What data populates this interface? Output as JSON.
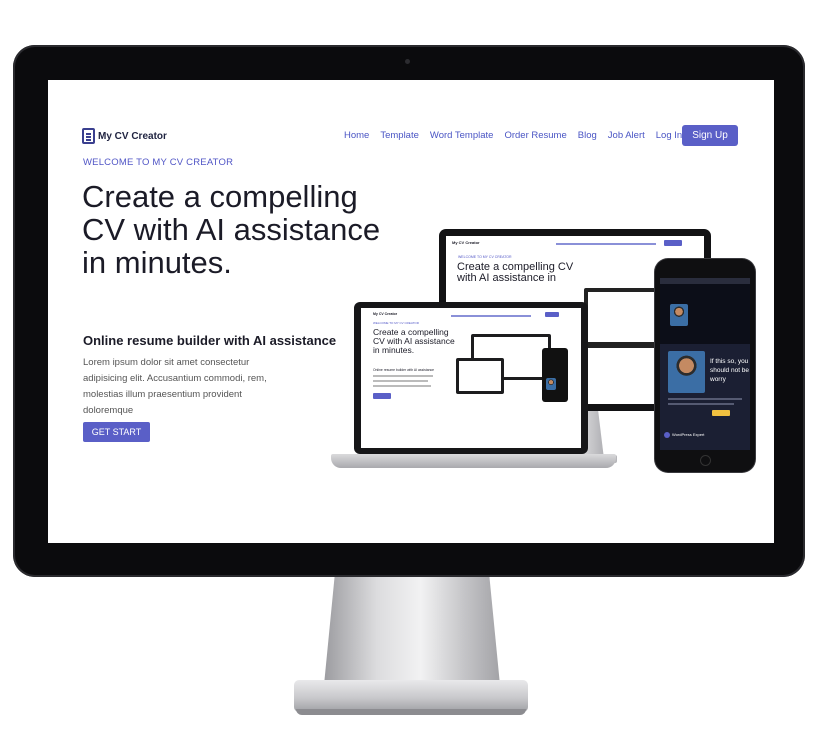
{
  "site": {
    "logo_text": "My CV Creator",
    "nav": [
      "Home",
      "Template",
      "Word Template",
      "Order Resume",
      "Blog",
      "Job Alert",
      "Log In"
    ],
    "signup_label": "Sign Up"
  },
  "hero": {
    "welcome": "WELCOME TO MY CV CREATOR",
    "headline": "Create a compelling CV with AI assistance in minutes.",
    "subheading": "Online resume builder with AI assistance",
    "description": "Lorem ipsum dolor sit amet consectetur adipisicing elit. Accusantium commodi, rem, molestias illum praesentium provident doloremque",
    "cta_label": "GET START"
  },
  "mockups": {
    "monitor": {
      "welcome": "WELCOME TO MY CV CREATOR",
      "headline": "Create a compelling CV with AI assistance in"
    },
    "laptop": {
      "welcome": "WELCOME TO MY CV CREATOR",
      "headline": "Create a compelling CV with AI assistance in minutes.",
      "subheading": "Online resume builder with AI assistance"
    },
    "phone": {
      "text": "If this so, you should not be worry",
      "badge": "WordPress Expert"
    }
  },
  "colors": {
    "accent": "#5a5fc7",
    "monitor_frame": "#0b0b0d",
    "text_dark": "#1b1b27"
  }
}
